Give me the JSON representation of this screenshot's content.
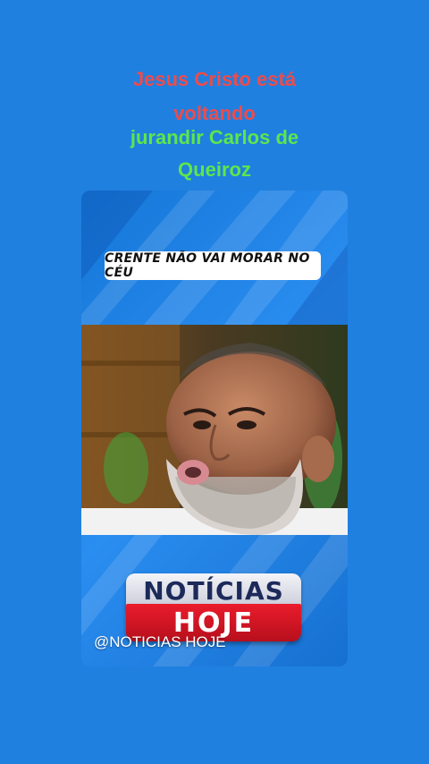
{
  "overlay": {
    "title_line1": "Jesus Cristo está",
    "title_line2": "voltando",
    "subtitle_line1": "jurandir Carlos de",
    "subtitle_line2": "Queiroz"
  },
  "video": {
    "caption": "CRENTE NÃO VAI MORAR NO CÉU",
    "badge_top": "NOTÍCIAS",
    "badge_bottom": "HOJE",
    "handle": "@NOTICIAS HOJE"
  },
  "colors": {
    "background": "#1f80e0",
    "title_red": "#ef4b4b",
    "subtitle_green": "#5ee64b",
    "badge_red": "#e01a2a"
  }
}
